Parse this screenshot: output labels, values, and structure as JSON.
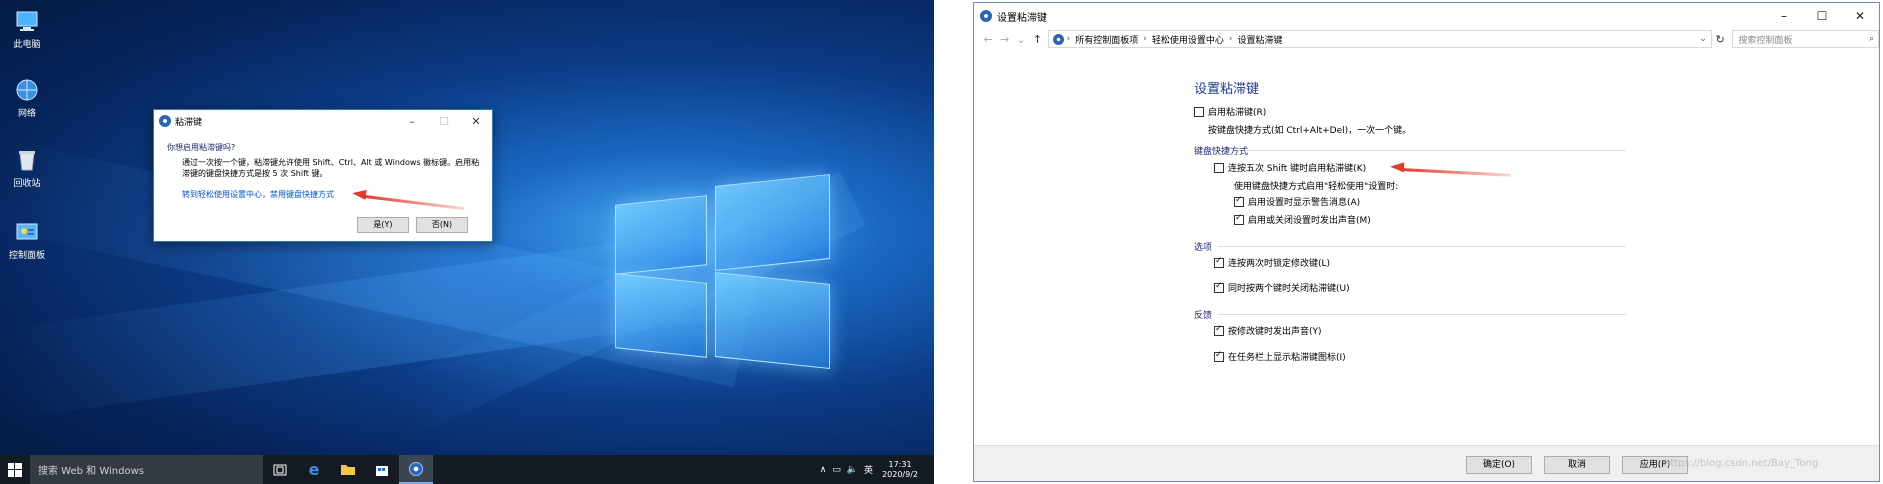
{
  "desktop": {
    "icons": [
      {
        "label": "此电脑",
        "icon": "computer-icon"
      },
      {
        "label": "网络",
        "icon": "network-icon"
      },
      {
        "label": "回收站",
        "icon": "recycle-bin-icon"
      },
      {
        "label": "控制面板",
        "icon": "control-panel-icon"
      }
    ],
    "dialog": {
      "title": "粘滞键",
      "question": "你想启用粘滞键吗?",
      "body": "通过一次按一个键，粘滞键允许使用 Shift、Ctrl、Alt 或 Windows 徽标键。启用粘滞键的键盘快捷方式是按 5 次 Shift 键。",
      "link": "转到轻松使用设置中心，禁用键盘快捷方式",
      "yes_label": "是(Y)",
      "no_label": "否(N)"
    },
    "taskbar": {
      "search_placeholder": "搜索 Web 和 Windows",
      "ime": "英",
      "time": "17:31",
      "date": "2020/9/2"
    }
  },
  "control_panel": {
    "window_title": "设置粘滞键",
    "breadcrumbs": [
      "所有控制面板项",
      "轻松使用设置中心",
      "设置粘滞键"
    ],
    "search_placeholder": "搜索控制面板",
    "heading": "设置粘滞键",
    "enable_sticky": {
      "label": "启用粘滞键(R)",
      "checked": false
    },
    "enable_desc": "按键盘快捷方式(如 Ctrl+Alt+Del)，一次一个键。",
    "keyboard_section": "键盘快捷方式",
    "shift5": {
      "label": "连按五次 Shift 键时启用粘滞键(K)",
      "checked": false
    },
    "shortcut_note": "使用键盘快捷方式启用\"轻松使用\"设置时:",
    "warn_msg": {
      "label": "启用设置时显示警告消息(A)",
      "checked": true
    },
    "sound_toggle": {
      "label": "启用或关闭设置时发出声音(M)",
      "checked": true
    },
    "options_section": "选项",
    "lock_modifier": {
      "label": "连按两次时锁定修改键(L)",
      "checked": true
    },
    "turn_off_two": {
      "label": "同时按两个键时关闭粘滞键(U)",
      "checked": true
    },
    "feedback_section": "反馈",
    "beep_modifier": {
      "label": "按修改键时发出声音(Y)",
      "checked": true
    },
    "show_taskbar_icon": {
      "label": "在任务栏上显示粘滞键图标(I)",
      "checked": true
    },
    "ok_label": "确定(O)",
    "cancel_label": "取消",
    "apply_label": "应用(P)",
    "watermark": "https://blog.csdn.net/Bay_Tong"
  }
}
